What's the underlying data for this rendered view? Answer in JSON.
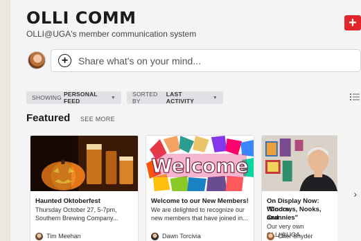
{
  "header": {
    "title": "OLLI COMM",
    "subtitle": "OLLI@UGA's member communication system",
    "add_icon": "plus-icon"
  },
  "composer": {
    "placeholder": "Share what's on your mind..."
  },
  "filters": {
    "feed_prefix": "SHOWING",
    "feed_value": "PERSONAL FEED",
    "sort_prefix": "SORTED BY",
    "sort_value": "LAST ACTIVITY"
  },
  "featured": {
    "title": "Featured",
    "see_more": "SEE MORE",
    "cards": [
      {
        "title": "Haunted Oktoberfest",
        "body_line1": "Thursday October 27, 5-7pm,",
        "body_line2": "Southern Brewing Company...",
        "author": "Tim Meehan"
      },
      {
        "image_text": "Welcome",
        "title": "Welcome to our New Members!",
        "body_line1": "We are delighted to recognize our",
        "body_line2": "new members that have joined in...",
        "author": "Dawn Torcivia"
      },
      {
        "title_line1": "On Display Now: \"Doors,",
        "title_line2": "Windows, Nooks, and",
        "title_line3": "Crannies\"",
        "body_line1": "Our very own OLLI@UGA",
        "author": "Cher Snyder"
      }
    ]
  },
  "colors": {
    "accent_red": "#e0252b",
    "background": "#f4f4f5",
    "chip": "#dfe1e5"
  }
}
